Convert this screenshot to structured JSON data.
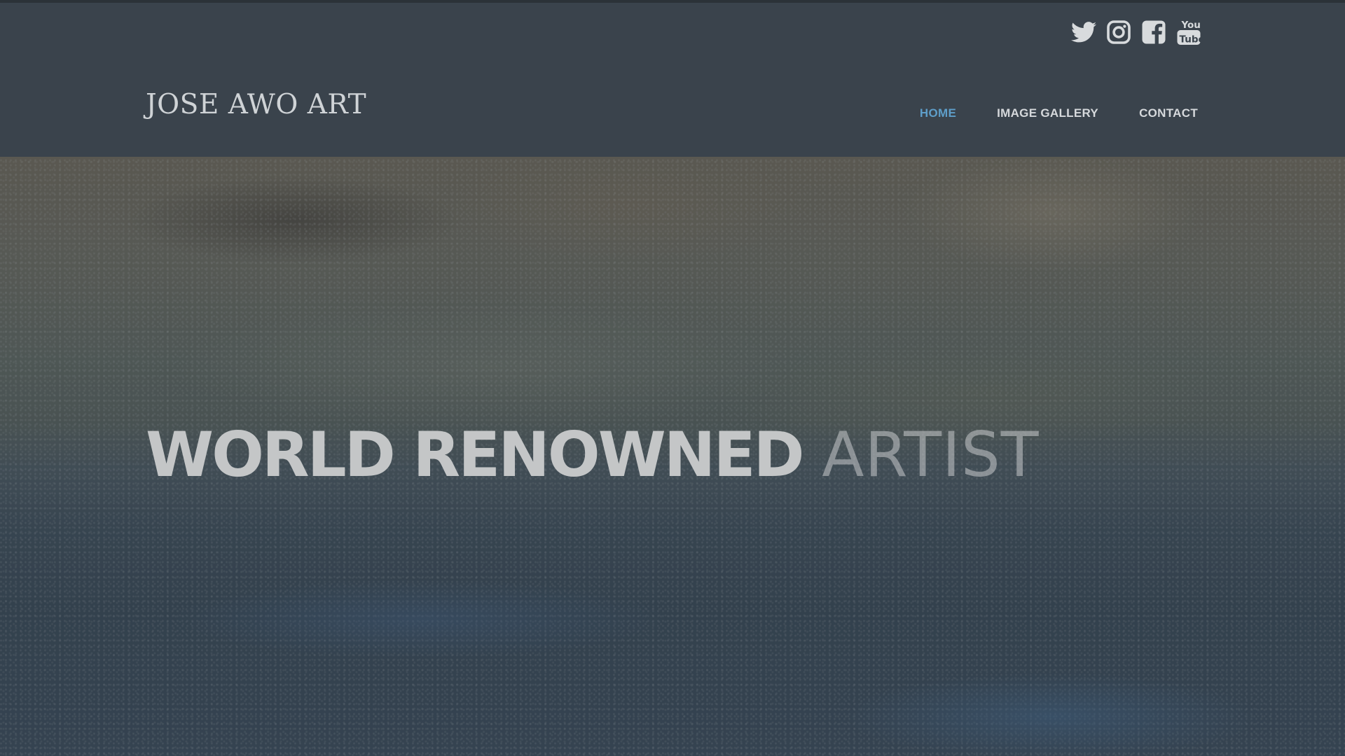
{
  "brand": {
    "name": "JOSE AWO ART"
  },
  "social": [
    {
      "name": "twitter-icon",
      "label": "Twitter"
    },
    {
      "name": "instagram-icon",
      "label": "Instagram"
    },
    {
      "name": "facebook-icon",
      "label": "Facebook"
    },
    {
      "name": "youtube-icon",
      "label": "YouTube"
    }
  ],
  "nav": {
    "items": [
      {
        "label": "HOME",
        "active": true
      },
      {
        "label": "IMAGE GALLERY",
        "active": false
      },
      {
        "label": "CONTACT",
        "active": false
      }
    ]
  },
  "hero": {
    "headline_bold": "WORLD RENOWNED",
    "headline_light": "ARTIST"
  },
  "colors": {
    "header_bg": "#3a434c",
    "nav_active": "#5e9ec9",
    "nav_text": "#d6d9dc"
  }
}
